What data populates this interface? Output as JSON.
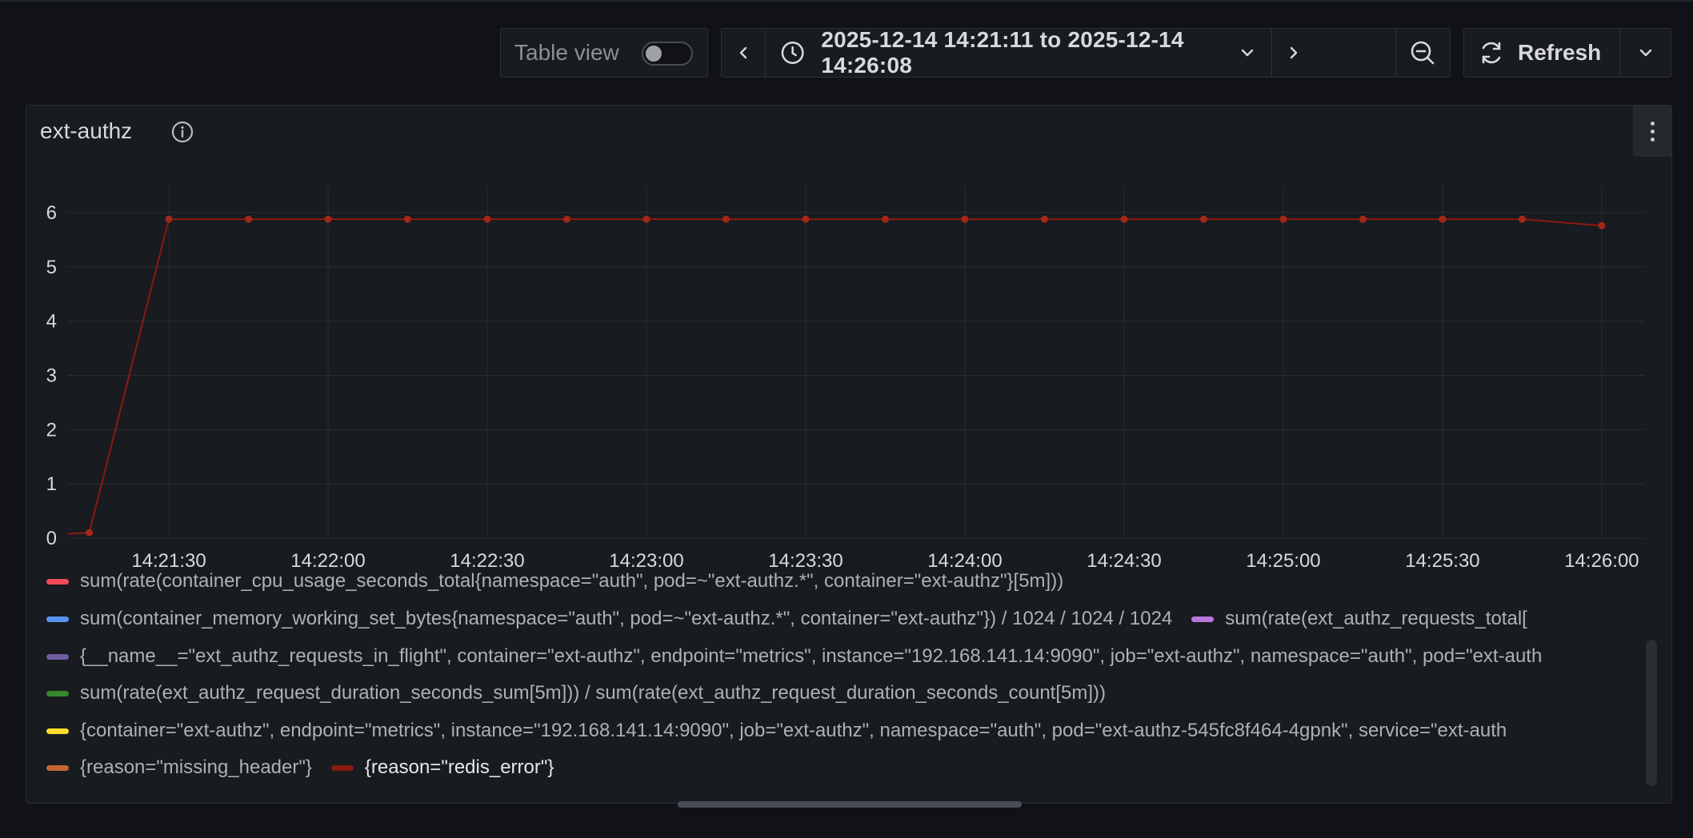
{
  "toolbar": {
    "table_view_label": "Table view",
    "time_range": "2025-12-14 14:21:11 to 2025-12-14 14:26:08",
    "refresh_label": "Refresh"
  },
  "panel": {
    "title": "ext-authz"
  },
  "colors": {
    "background": "#111217",
    "panel": "#181b1f",
    "grid": "#2a2d33",
    "series_line": "#8b1a10",
    "series_point": "#a3271b"
  },
  "legend": [
    {
      "label": "sum(rate(container_cpu_usage_seconds_total{namespace=\"auth\", pod=~\"ext-authz.*\", container=\"ext-authz\"}[5m]))",
      "color": "#f2495c"
    },
    {
      "label": "sum(container_memory_working_set_bytes{namespace=\"auth\", pod=~\"ext-authz.*\", container=\"ext-authz\"}) / 1024 / 1024 / 1024",
      "color": "#5794f2"
    },
    {
      "label": "sum(rate(ext_authz_requests_total[",
      "color": "#b877d9"
    },
    {
      "label": "{__name__=\"ext_authz_requests_in_flight\", container=\"ext-authz\", endpoint=\"metrics\", instance=\"192.168.141.14:9090\", job=\"ext-authz\", namespace=\"auth\", pod=\"ext-auth",
      "color": "#705da0"
    },
    {
      "label": "sum(rate(ext_authz_request_duration_seconds_sum[5m])) / sum(rate(ext_authz_request_duration_seconds_count[5m]))",
      "color": "#37872d"
    },
    {
      "label": "{container=\"ext-authz\", endpoint=\"metrics\", instance=\"192.168.141.14:9090\", job=\"ext-authz\", namespace=\"auth\", pod=\"ext-authz-545fc8f464-4gpnk\", service=\"ext-auth",
      "color": "#fade2a"
    },
    {
      "label": "{reason=\"missing_header\"}",
      "color": "#c4662f"
    },
    {
      "label": "{reason=\"redis_error\"}",
      "color": "#8b1a10"
    }
  ],
  "chart_data": {
    "type": "line",
    "x_ticks": [
      "14:21:30",
      "14:22:00",
      "14:22:30",
      "14:23:00",
      "14:23:30",
      "14:24:00",
      "14:24:30",
      "14:25:00",
      "14:25:30",
      "14:26:00"
    ],
    "y_ticks": [
      "0",
      "1",
      "2",
      "3",
      "4",
      "5",
      "6"
    ],
    "ylim": [
      0,
      6.5
    ],
    "xlim": [
      "14:21:11",
      "14:26:08"
    ],
    "grid": true,
    "legend_position": "bottom",
    "series": [
      {
        "name": "{reason=\"redis_error\"}",
        "x": [
          "14:21:11",
          "14:21:15",
          "14:21:30",
          "14:21:45",
          "14:22:00",
          "14:22:15",
          "14:22:30",
          "14:22:45",
          "14:23:00",
          "14:23:15",
          "14:23:30",
          "14:23:45",
          "14:24:00",
          "14:24:15",
          "14:24:30",
          "14:24:45",
          "14:25:00",
          "14:25:15",
          "14:25:30",
          "14:25:45",
          "14:26:00"
        ],
        "y": [
          0.08,
          0.1,
          5.88,
          5.88,
          5.88,
          5.88,
          5.88,
          5.88,
          5.88,
          5.88,
          5.88,
          5.88,
          5.88,
          5.88,
          5.88,
          5.88,
          5.88,
          5.88,
          5.88,
          5.88,
          5.76
        ],
        "markers": [
          false,
          true,
          true,
          true,
          true,
          true,
          true,
          true,
          true,
          true,
          true,
          true,
          true,
          true,
          true,
          true,
          true,
          true,
          true,
          true,
          true
        ]
      }
    ]
  }
}
